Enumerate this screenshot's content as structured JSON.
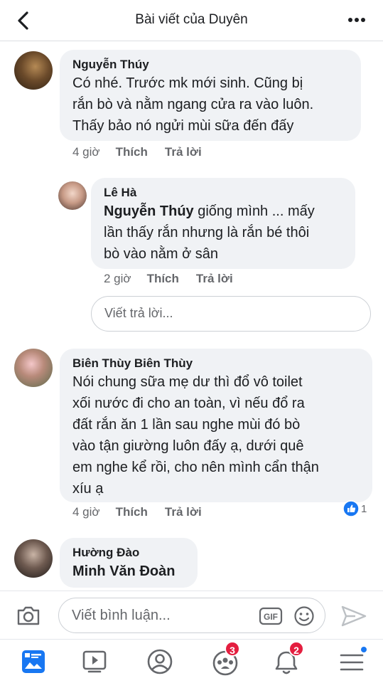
{
  "header": {
    "title": "Bài viết của Duyên",
    "back_icon": "chevron-left-icon",
    "more_icon": "more-dots-icon"
  },
  "comments": [
    {
      "author": "Nguyễn Thúy",
      "lines": [
        "Có nhé. Trước mk mới sinh. Cũng bị",
        "rắn bò và nằm ngang cửa ra vào luôn.",
        "Thấy bảo nó ngửi mùi sữa đến đấy"
      ],
      "time": "4 giờ",
      "like": "Thích",
      "reply": "Trả lời"
    },
    {
      "author": "Lê Hà",
      "mention": "Nguyễn Thúy",
      "lines": [
        " giống mình ... mấy",
        "lần thấy rắn nhưng là rắn bé thôi",
        "bò vào nằm ở sân"
      ],
      "time": "2 giờ",
      "like": "Thích",
      "reply": "Trả lời"
    },
    {
      "author": "Biên Thùy Biên Thùy",
      "lines": [
        "Nói chung sữa mẹ dư thì đổ vô toilet",
        "xối nước đi cho an toàn, vì nếu đổ ra",
        "đất rắn ăn 1 lần sau nghe mùi đó bò",
        "vào tận giường luôn đấy ạ, dưới quê",
        "em nghe kể rồi, cho nên mình cẩn thận",
        "xíu ạ"
      ],
      "time": "4 giờ",
      "like": "Thích",
      "reply": "Trả lời",
      "reaction_count": "1"
    },
    {
      "author": "Hường Đào",
      "lines": [
        "Minh Văn Đoàn"
      ]
    }
  ],
  "reply_box": {
    "placeholder": "Viết trả lời..."
  },
  "composer": {
    "placeholder": "Viết bình luận...",
    "gif_label": "GIF"
  },
  "nav": {
    "groups_badge": "3",
    "notifications_badge": "2"
  },
  "colors": {
    "accent": "#1877f2",
    "badge": "#e41e3f",
    "bubble": "#f0f2f5"
  }
}
